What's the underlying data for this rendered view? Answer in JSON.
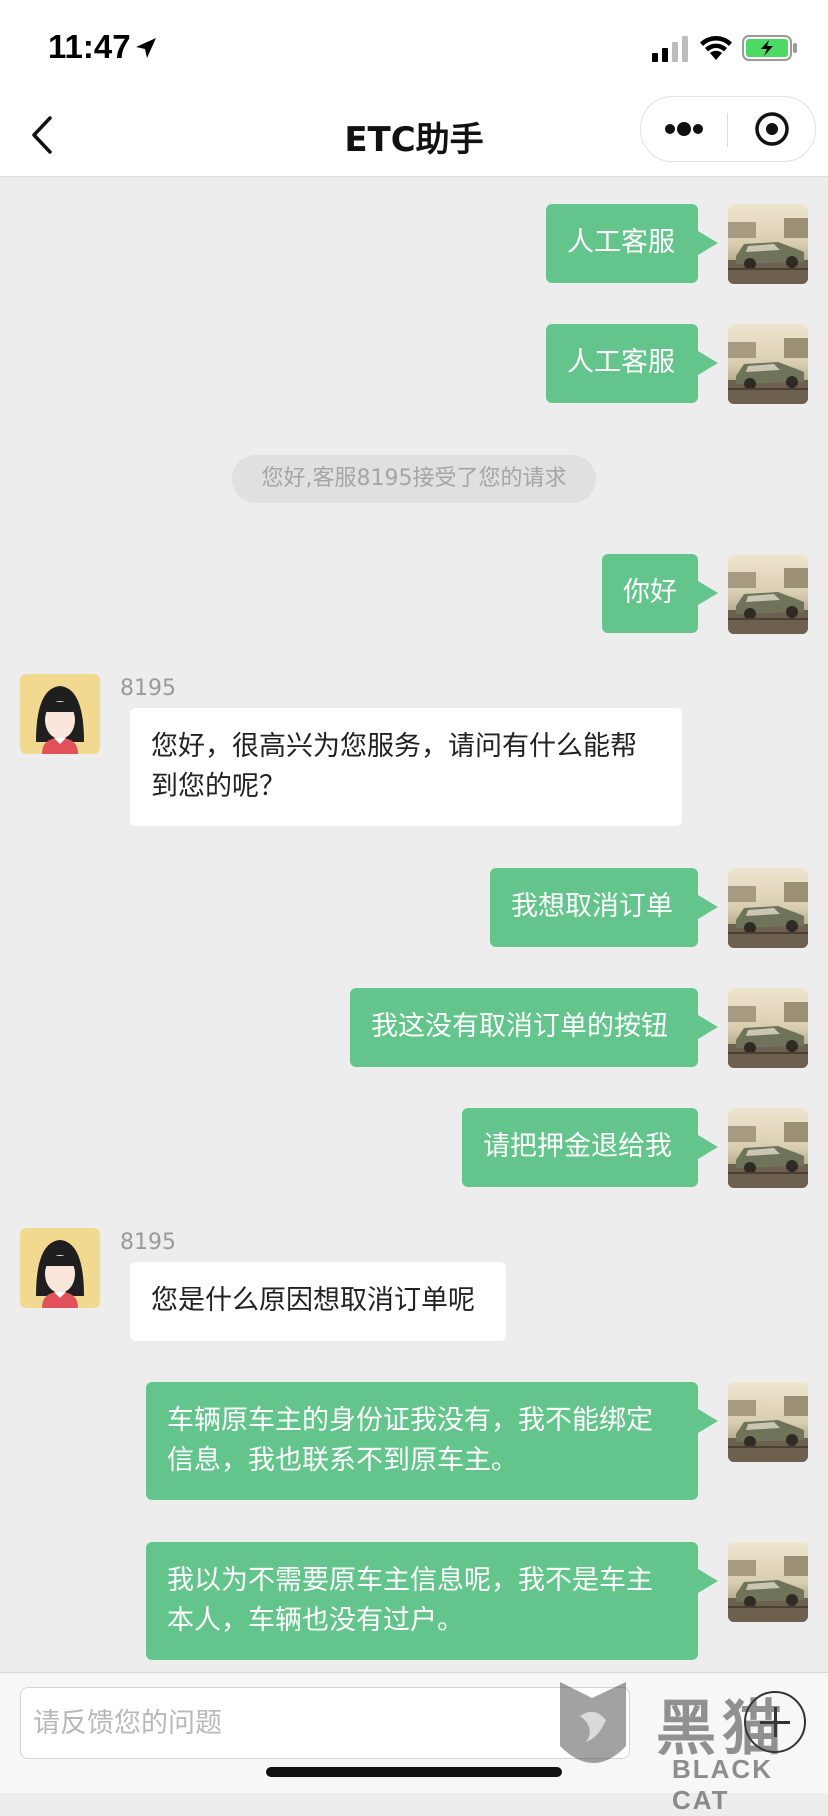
{
  "status_bar": {
    "time": "11:47"
  },
  "nav": {
    "title": "ETC助手"
  },
  "messages": {
    "m1": "人工客服",
    "m2": "人工客服",
    "system": "您好,客服8195接受了您的请求",
    "m3": "你好",
    "agent1_name": "8195",
    "agent1_text": "您好，很高兴为您服务，请问有什么能帮\n到您的呢？",
    "m4": "我想取消订单",
    "m5": "我这没有取消订单的按钮",
    "m6": "请把押金退给我",
    "agent2_name": "8195",
    "agent2_text": "您是什么原因想取消订单呢",
    "m7": "车辆原车主的身份证我没有，我不能绑定\n信息，我也联系不到原车主。",
    "m8": "我以为不需要原车主信息呢，我不是车主\n本人，车辆也没有过户。"
  },
  "input": {
    "placeholder": "请反馈您的问题",
    "value": ""
  },
  "watermark": {
    "cn": "黑猫",
    "en": "BLACK CAT"
  },
  "colors": {
    "outgoing_bubble": "#63c58c",
    "incoming_bubble": "#ffffff",
    "background": "#ededed"
  },
  "icons": [
    "location-arrow-icon",
    "signal-icon",
    "wifi-icon",
    "battery-icon",
    "back-chevron-icon",
    "more-icon",
    "close-target-icon",
    "plus-icon",
    "cat-logo-icon"
  ]
}
